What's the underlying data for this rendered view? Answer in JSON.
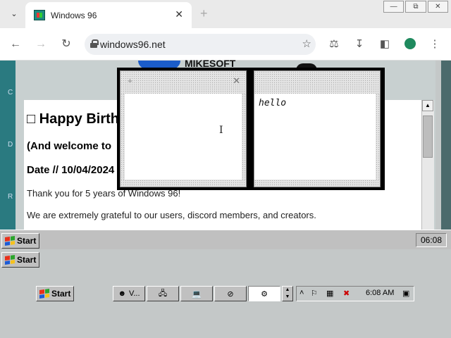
{
  "browser": {
    "tab_title": "Windows 96",
    "url": "windows96.net",
    "icons": [
      "chevron-down-icon",
      "favicon-icon",
      "close-icon",
      "plus-icon",
      "back-icon",
      "forward-icon",
      "reload-icon",
      "lock-icon",
      "star-icon",
      "flask-icon",
      "download-icon",
      "sidebar-icon",
      "profile-icon",
      "menu-icon"
    ]
  },
  "page": {
    "logo_text": "MIKESOFT",
    "side_letters": [
      "C",
      "D",
      "R"
    ],
    "heading": "□ Happy Birthday",
    "subheading": "(And welcome to",
    "date_line": "Date // 10/04/2024",
    "paragraph1": "Thank you for 5 years of Windows 96!",
    "paragraph2": "We are extremely grateful to our users, discord members, and creators."
  },
  "notes": {
    "note_text": "hello"
  },
  "taskbar_top": {
    "start_label": "Start",
    "clock": "06:08"
  },
  "taskbar_mid": {
    "start_label": "Start"
  },
  "taskbar_bottom": {
    "start_label": "Start",
    "task1_label": "V...",
    "clock": "6:08 AM"
  },
  "colors": {
    "windows_logo": [
      "#e8301a",
      "#2ba52b",
      "#1c5bd6",
      "#f6c21c"
    ]
  }
}
